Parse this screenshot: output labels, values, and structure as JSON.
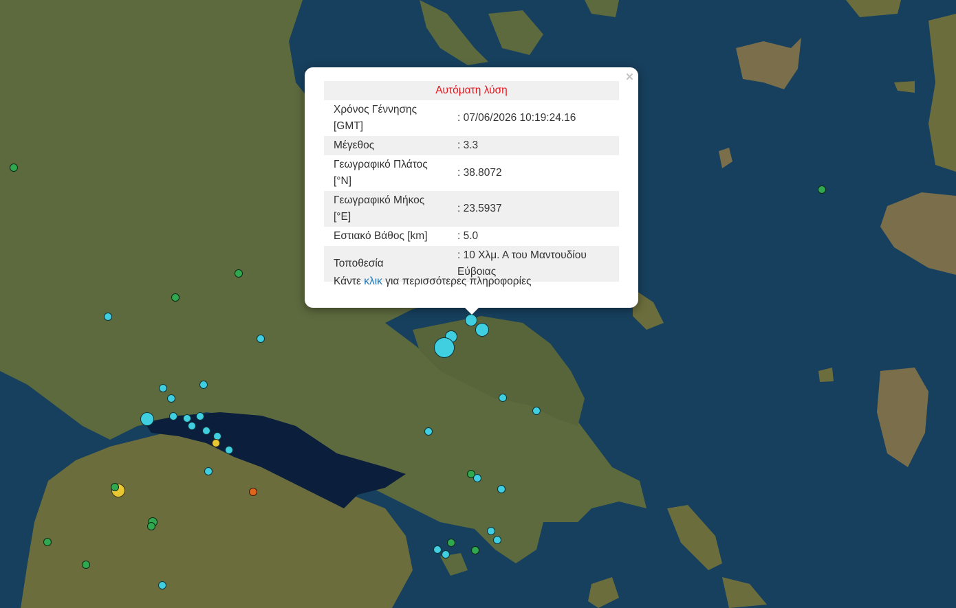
{
  "popup": {
    "title": "Αυτόματη λύση",
    "close_label": "×",
    "rows": [
      {
        "label": "Χρόνος Γέννησης [GMT]",
        "value": ": 07/06/2026 10:19:24.16"
      },
      {
        "label": "Μέγεθος",
        "value": ": 3.3"
      },
      {
        "label": "Γεωγραφικό Πλάτος [°N]",
        "value": ": 38.8072"
      },
      {
        "label": "Γεωγραφικό Μήκος [°E]",
        "value": ": 23.5937"
      },
      {
        "label": "Εστιακό Βάθος [km]",
        "value": ": 5.0"
      },
      {
        "label": "Τοποθεσία",
        "value": ": 10 Χλμ. Α του Μαντουδίου Εύβοιας"
      }
    ],
    "footer_prefix": "Κάντε",
    "footer_link": "κλικ",
    "footer_suffix": "για περισσότερες πληροφορίες"
  },
  "colors": {
    "sea": "#17405e",
    "land": "#5d6a3e",
    "gulf": "#0b1f3d",
    "marker_cyan": "#3fcfe0",
    "marker_green": "#2fa84f",
    "marker_yellow": "#e8c832",
    "marker_orange": "#e0661c",
    "title_red": "#e8141c",
    "link_blue": "#1a75b8"
  },
  "markers": [
    {
      "color": "green",
      "selected": false
    },
    {
      "color": "green",
      "selected": false
    },
    {
      "color": "green",
      "selected": false
    },
    {
      "color": "cyan",
      "selected": false
    },
    {
      "color": "cyan",
      "selected": false
    },
    {
      "color": "cyan",
      "selected": true
    },
    {
      "color": "cyan",
      "selected": false
    },
    {
      "color": "cyan",
      "selected": false
    },
    {
      "color": "cyan",
      "selected": false
    },
    {
      "color": "green",
      "selected": false
    },
    {
      "color": "cyan",
      "selected": false
    },
    {
      "color": "cyan",
      "selected": false
    },
    {
      "color": "cyan",
      "selected": false
    },
    {
      "color": "cyan",
      "selected": false
    },
    {
      "color": "cyan",
      "selected": false
    },
    {
      "color": "cyan",
      "selected": false
    },
    {
      "color": "cyan",
      "selected": false
    },
    {
      "color": "cyan",
      "selected": false
    },
    {
      "color": "cyan",
      "selected": false
    },
    {
      "color": "yellow",
      "selected": false
    },
    {
      "color": "cyan",
      "selected": false
    },
    {
      "color": "cyan",
      "selected": false
    },
    {
      "color": "cyan",
      "selected": false
    },
    {
      "color": "cyan",
      "selected": false
    },
    {
      "color": "cyan",
      "selected": false
    },
    {
      "color": "green",
      "selected": false
    },
    {
      "color": "cyan",
      "selected": false
    },
    {
      "color": "cyan",
      "selected": false
    },
    {
      "color": "orange",
      "selected": false
    },
    {
      "color": "yellow",
      "selected": false
    },
    {
      "color": "green",
      "selected": false
    },
    {
      "color": "green",
      "selected": false
    },
    {
      "color": "green",
      "selected": false
    },
    {
      "color": "green",
      "selected": false
    },
    {
      "color": "green",
      "selected": false
    },
    {
      "color": "cyan",
      "selected": false
    },
    {
      "color": "cyan",
      "selected": false
    },
    {
      "color": "cyan",
      "selected": false
    },
    {
      "color": "cyan",
      "selected": false
    },
    {
      "color": "green",
      "selected": false
    },
    {
      "color": "green",
      "selected": false
    },
    {
      "color": "cyan",
      "selected": false
    },
    {
      "color": "cyan",
      "selected": false
    }
  ]
}
